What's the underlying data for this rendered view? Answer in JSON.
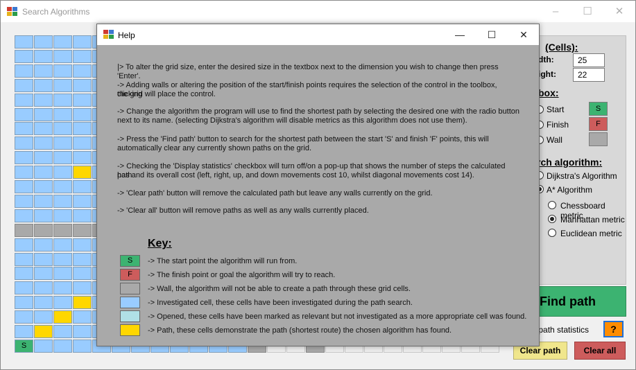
{
  "main_window": {
    "title": "Search Algorithms",
    "controls": {
      "minimize": "–",
      "maximize": "☐",
      "close": "✕"
    }
  },
  "panel": {
    "grid_size_heading": "(Cells):",
    "width_label": "dth:",
    "width_value": "25",
    "height_label": "ight:",
    "height_value": "22",
    "toolbox_heading": "box:",
    "tool_start": "Start",
    "tool_finish": "Finish",
    "tool_wall": "Wall",
    "start_symbol": "S",
    "finish_symbol": "F",
    "algorithm_heading": "rch algorithm:",
    "algo_dijkstra": "Dijkstra's Algorithm",
    "algo_astar": "A* Algorithm",
    "metric_chessboard": "Chessboard metric",
    "metric_manhattan": "Manhattan metric",
    "metric_euclidean": "Euclidean metric",
    "find_path": "Find path",
    "display_stats": "play path statistics",
    "help_symbol": "?",
    "clear_path": "Clear path",
    "clear_all": "Clear all"
  },
  "grid": {
    "start_label": "S"
  },
  "colors": {
    "investigated": "#99ccff",
    "opened": "#b0e0e6",
    "wall": "#a9a9a9",
    "path": "#ffd700",
    "start": "#3cb371",
    "finish": "#cd5c5c",
    "help_button": "#ff8c00",
    "clear_path_button": "#f0e68c"
  },
  "help": {
    "title": "Help",
    "controls": {
      "minimize": "—",
      "maximize": "☐",
      "close": "✕"
    },
    "lines": [
      "|> To alter the grid size, enter the desired size in the textbox next to the dimension you wish to change then press 'Enter'.",
      "-> Adding walls or altering the position of the start/finish points requires the selection of the control in the toolbox, clicking",
      "the grid will place the control.",
      "-> Change the algorithm the program will use to find the shortest path by selecting the desired one with the radio button",
      "next to its name. (selecting Dijkstra's algorithm will disable metrics as this algorithm does not use them).",
      "-> Press the 'Find path' button to search for the shortest path between the start 'S' and finish 'F' points, this will",
      "automatically clear any currently shown paths on the grid.",
      "-> Checking the 'Display statistics' checkbox will turn off/on a pop-up that shows the number of steps the calculated path",
      "has and its overall cost (left, right, up, and down movements cost 10, whilst diagonal movements cost 14).",
      "-> 'Clear path' button will remove the calculated path but leave any walls currently on the grid.",
      "-> 'Clear all' button will remove paths as well as any walls currently placed."
    ],
    "key_heading": "Key:",
    "key_items": [
      {
        "symbol": "S",
        "text": "-> The start point the algorithm will run from."
      },
      {
        "symbol": "F",
        "text": "-> The finish point or goal the algorithm will try to reach."
      },
      {
        "symbol": "",
        "text": "-> Wall, the algorithm will not be able to create a path through these grid cells."
      },
      {
        "symbol": "",
        "text": "-> Investigated cell, these cells have been investigated during the path search."
      },
      {
        "symbol": "",
        "text": "-> Opened, these cells have been marked as relevant but not investigated as a more appropriate cell was found."
      },
      {
        "symbol": "",
        "text": "-> Path, these cells demonstrate the path (shortest route) the chosen algorithm has found."
      }
    ]
  }
}
